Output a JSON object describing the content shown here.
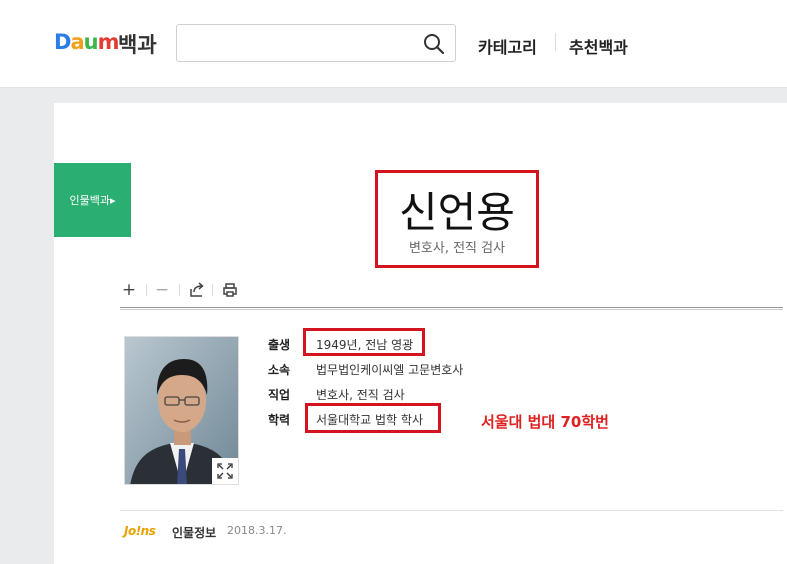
{
  "header": {
    "logo_letters": [
      "D",
      "a",
      "u",
      "m"
    ],
    "service_name": "백과",
    "search": {
      "value": "",
      "placeholder": ""
    },
    "nav": {
      "category": "카테고리",
      "recommended": "추천백과"
    }
  },
  "sidebar": {
    "tab_label": "인물백과▸"
  },
  "article": {
    "title": "신언용",
    "subtitle": "변호사, 전직 검사",
    "toolbar": {
      "zoom_in": "+",
      "zoom_out": "−"
    },
    "info": [
      {
        "label": "출생",
        "value": "1949년, 전남 영광"
      },
      {
        "label": "소속",
        "value": "법무법인케이씨엘 고문변호사"
      },
      {
        "label": "직업",
        "value": "변호사, 전직 검사"
      },
      {
        "label": "학력",
        "value": "서울대학교 법학 학사"
      }
    ],
    "annotation": "서울대 법대 70학번",
    "source": {
      "logo": "Jo!ns",
      "name": "인물정보",
      "date": "2018.3.17."
    }
  },
  "colors": {
    "accent_green": "#2bae72",
    "highlight_red": "#d3131f",
    "annotation_red": "#e02020",
    "logo": [
      "#2a7ee6",
      "#f0a11b",
      "#3cb54a",
      "#e23d32"
    ]
  }
}
